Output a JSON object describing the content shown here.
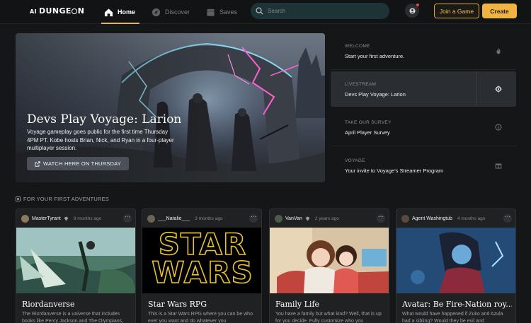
{
  "brand": {
    "logo_prefix": "AI",
    "logo_text": "DUNGE",
    "logo_suffix": "N"
  },
  "nav": {
    "home_label": "Home",
    "discover_label": "Discover",
    "saves_label": "Saves",
    "search_placeholder": "Search"
  },
  "actions": {
    "join_label": "Join a Game",
    "create_label": "Create"
  },
  "colors": {
    "accent": "#f2b441",
    "background": "#151617",
    "card": "#1f2123",
    "search": "#1d3336"
  },
  "hero": {
    "title": "Devs Play Voyage: Larion",
    "description": "Voyage gameplay goes public for the first time Thursday 4PM PT. Kobe hosts Brian, Nick, and Ryan in a four-player multiplayer session.",
    "button_label": "WATCH HERE ON THURSDAY"
  },
  "side_items": [
    {
      "category": "WELCOME",
      "title": "Start your first adventure.",
      "icon": "flame-icon"
    },
    {
      "category": "LIVESTREAM",
      "title": "Devs Play Voyage: Larion",
      "icon": "gear-icon"
    },
    {
      "category": "TAKE OUR SURVEY",
      "title": "April Player Survey",
      "icon": "info-icon"
    },
    {
      "category": "VOYAGE",
      "title": "Your invite to Voyage's Streamer Program",
      "icon": "gift-icon"
    }
  ],
  "section": {
    "title": "FOR YOUR FIRST ADVENTURES"
  },
  "cards": [
    {
      "user": "MasterTyrant",
      "time": "9 months ago",
      "title": "Riordanverse",
      "description": "The Riordanverse is a universe that includes books like Percy Jackson and The Olympians,"
    },
    {
      "user": "___Natalie___",
      "time": "3 months ago",
      "title": "Star Wars RPG",
      "description": "This is a Star Wars RPG where you can be who ever you want and do whatever you"
    },
    {
      "user": "VanVan",
      "time": "2 years ago",
      "title": "Family Life",
      "description": "You have a family but what kind? Well, that is up for you decide. Fully customize who you"
    },
    {
      "user": "Agent Washingtub",
      "time": "4 months ago",
      "title": "Avatar: Be Fire-Nation roy...",
      "description": "What would have happened if Zuko and Azula had a sibling? Would they be evil and"
    }
  ],
  "card_image_text": {
    "star": "STAR",
    "wars": "WARS"
  }
}
